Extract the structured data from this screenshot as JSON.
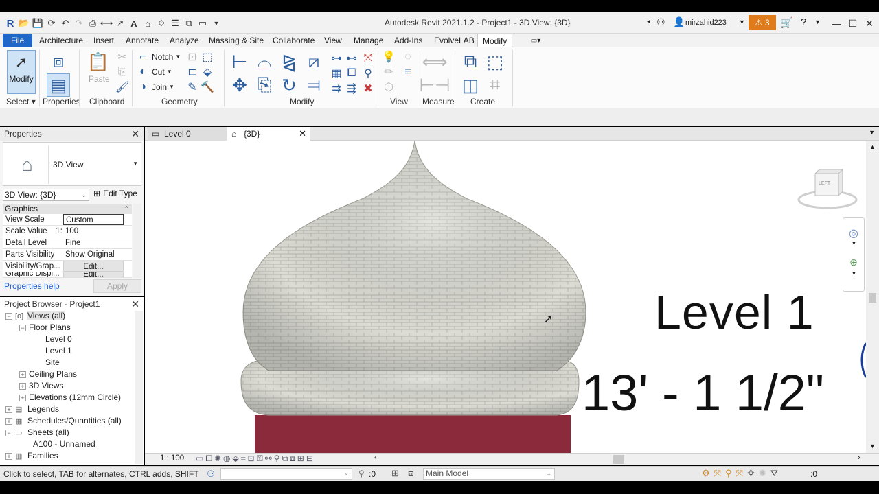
{
  "app": {
    "title": "Autodesk Revit 2021.1.2 - Project1 - 3D View: {3D}",
    "user": "mirzahid223",
    "alerts": "3"
  },
  "ribbon": {
    "tabs": [
      "File",
      "Architecture",
      "Insert",
      "Annotate",
      "Analyze",
      "Massing & Site",
      "Collaborate",
      "View",
      "Manage",
      "Add-Ins",
      "EvolveLAB",
      "Modify"
    ],
    "active_tab": "Modify",
    "modify_label": "Modify",
    "paste_label": "Paste",
    "notch_label": "Notch",
    "cut_label": "Cut",
    "join_label": "Join",
    "panels": {
      "select": "Select",
      "properties": "Properties",
      "clipboard": "Clipboard",
      "geometry": "Geometry",
      "modify": "Modify",
      "view": "View",
      "measure": "Measure",
      "create": "Create"
    }
  },
  "properties": {
    "title": "Properties",
    "type_name": "3D View",
    "view_selector": "3D View: {3D}",
    "edit_type": "Edit Type",
    "group": "Graphics",
    "rows": [
      {
        "key": "View Scale",
        "value": "Custom"
      },
      {
        "key": "Scale Value    1:",
        "value": "100"
      },
      {
        "key": "Detail Level",
        "value": "Fine"
      },
      {
        "key": "Parts Visibility",
        "value": "Show Original"
      },
      {
        "key": "Visibility/Grap...",
        "value": "Edit..."
      },
      {
        "key": "Graphic Displ...",
        "value": "Edit..."
      }
    ],
    "help_link": "Properties help",
    "apply": "Apply"
  },
  "browser": {
    "title": "Project Browser - Project1",
    "items": [
      {
        "label": "Views (all)",
        "level": 0
      },
      {
        "label": "Floor Plans",
        "level": 1
      },
      {
        "label": "Level 0",
        "level": 2
      },
      {
        "label": "Level 1",
        "level": 2
      },
      {
        "label": "Site",
        "level": 2
      },
      {
        "label": "Ceiling Plans",
        "level": 1
      },
      {
        "label": "3D Views",
        "level": 1
      },
      {
        "label": "Elevations (12mm Circle)",
        "level": 1
      },
      {
        "label": "Legends",
        "level": 0
      },
      {
        "label": "Schedules/Quantities (all)",
        "level": 0
      },
      {
        "label": "Sheets (all)",
        "level": 0
      },
      {
        "label": "A100 - Unnamed",
        "level": 1
      },
      {
        "label": "Families",
        "level": 0
      }
    ]
  },
  "view": {
    "tabs": [
      {
        "label": "Level 0"
      },
      {
        "label": "{3D}"
      }
    ],
    "level_name": "Level 1",
    "level_elevation": "13' - 1 1/2\"",
    "viewcube_face": "LEFT",
    "scale": "1 : 100"
  },
  "status": {
    "message": "Click to select, TAB for alternates, CTRL adds, SHIFT unselects.",
    "count": ":0",
    "model": "Main Model",
    "filter_count": ":0"
  },
  "colors": {
    "file_tab": "#1f67c8",
    "alert": "#e07b1b",
    "dome": "#d7d7d0",
    "base": "#8b2a3a"
  }
}
